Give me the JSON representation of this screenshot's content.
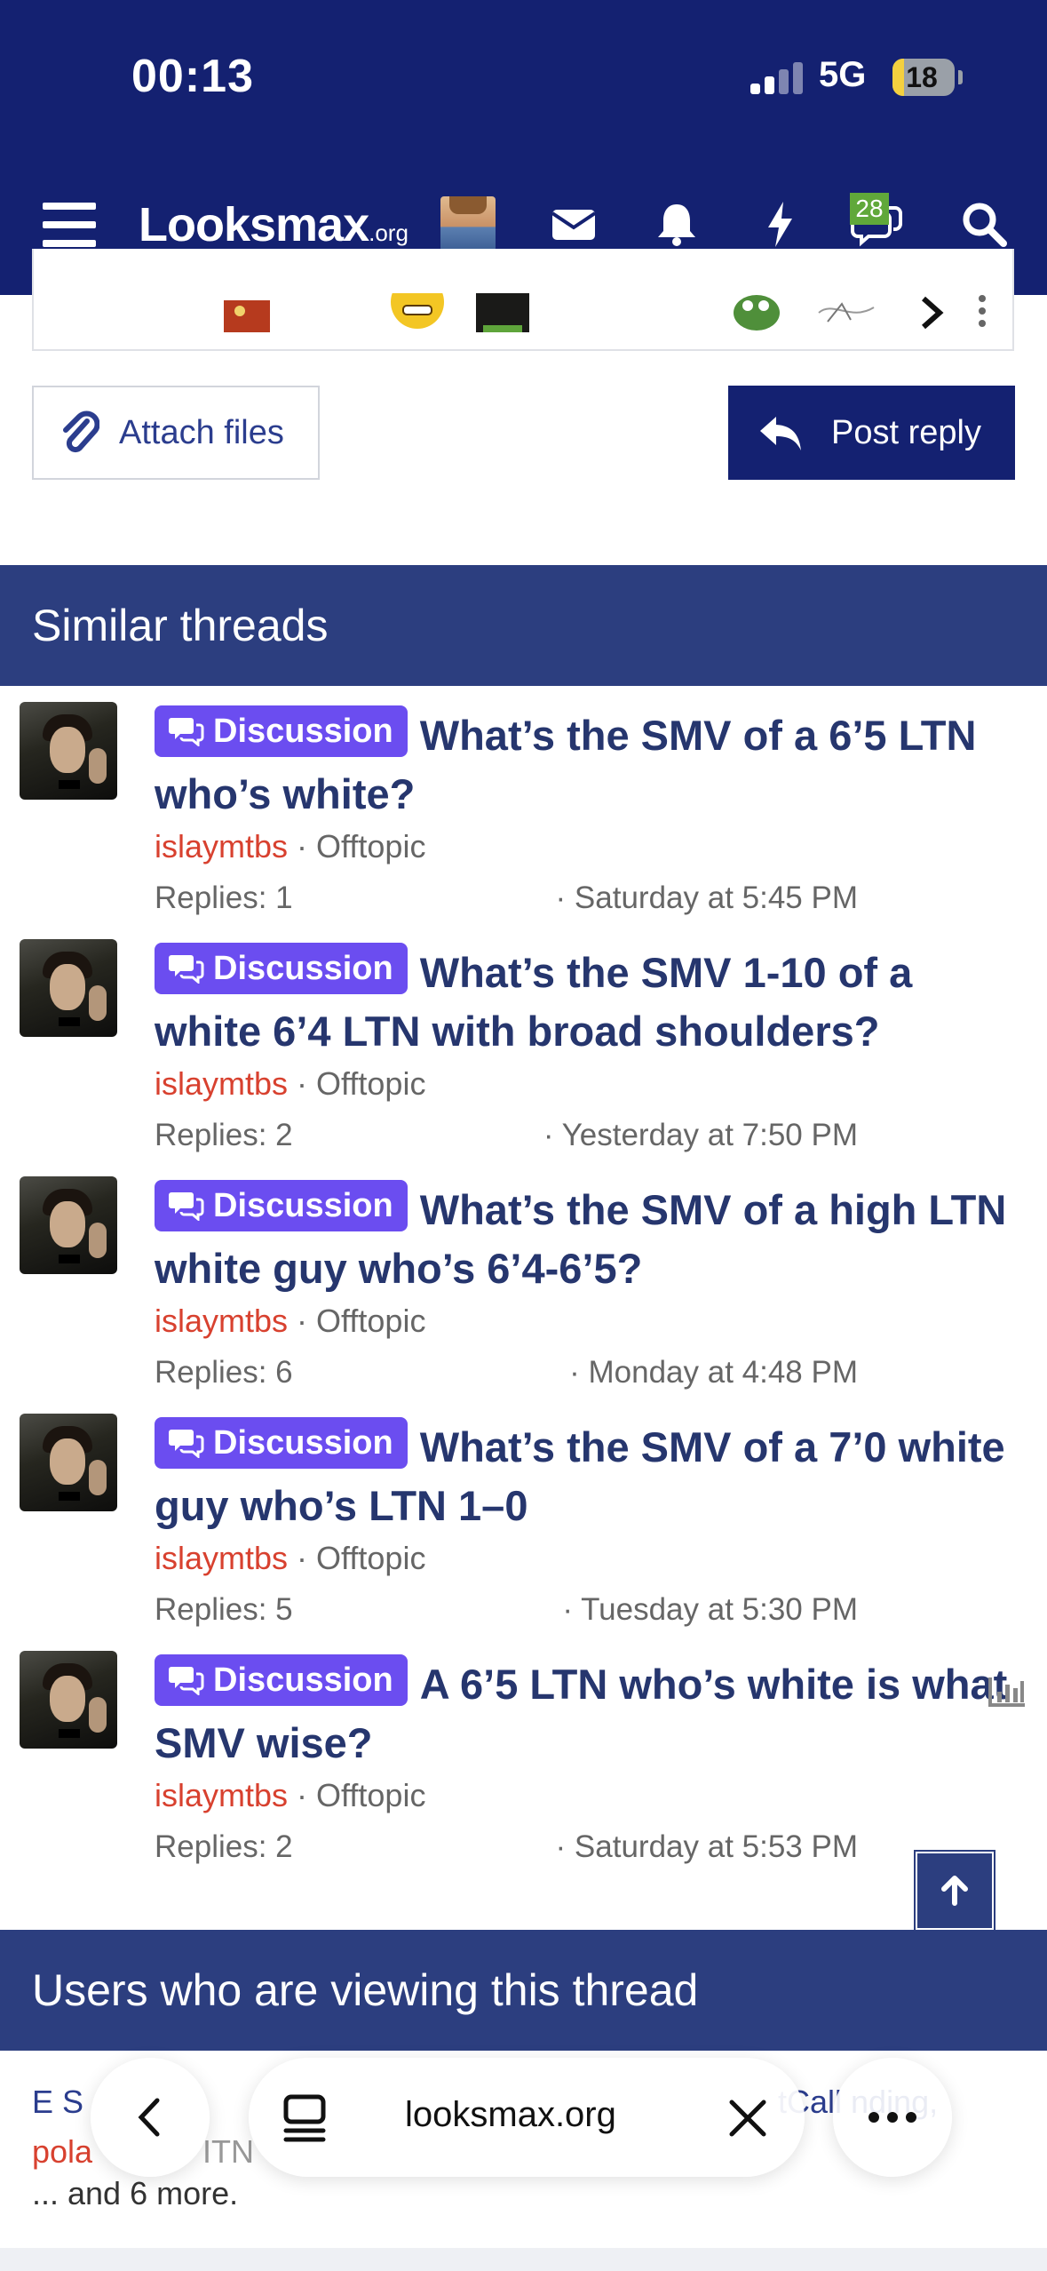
{
  "status_bar": {
    "time": "00:13",
    "network": "5G",
    "battery": "18",
    "battery_level": 0.18
  },
  "header": {
    "brand": "Looksmax",
    "brand_suffix": ".org",
    "conversations_badge": "28",
    "icons": [
      "menu-icon",
      "user-avatar",
      "mail-icon",
      "bell-icon",
      "lightning-icon",
      "chat-bubbles-icon",
      "search-icon"
    ]
  },
  "actions": {
    "attach_label": "Attach files",
    "post_label": "Post reply"
  },
  "similar": {
    "heading": "Similar threads",
    "threads": [
      {
        "prefix": "Discussion",
        "title": "What’s the SMV of a 6’5 LTN who’s white?",
        "author": "islaymtbs",
        "forum": "Offtopic",
        "replies": "Replies: 1",
        "date": "Saturday at 5:45 PM"
      },
      {
        "prefix": "Discussion",
        "title": "What’s the SMV 1-10 of a white 6’4 LTN with broad shoulders?",
        "author": "islaymtbs",
        "forum": "Offtopic",
        "replies": "Replies: 2",
        "date": "Yesterday at 7:50 PM"
      },
      {
        "prefix": "Discussion",
        "title": "What’s the SMV of a high LTN white guy who’s 6’4-6’5?",
        "author": "islaymtbs",
        "forum": "Offtopic",
        "replies": "Replies: 6",
        "date": "Monday at 4:48 PM"
      },
      {
        "prefix": "Discussion",
        "title": "What’s the SMV of a 7’0 white guy who’s LTN 1–0",
        "author": "islaymtbs",
        "forum": "Offtopic",
        "replies": "Replies: 5",
        "date": "Tuesday at 5:30 PM"
      },
      {
        "prefix": "Discussion",
        "title": "A 6’5 LTN who’s white is what SMV wise?",
        "author": "islaymtbs",
        "forum": "Offtopic",
        "replies": "Replies: 2",
        "date": "Saturday at 5:53 PM",
        "has_poll": true
      }
    ]
  },
  "viewers": {
    "heading": "Users who are viewing this thread",
    "line1": "E S",
    "line1_end": "tCall nding,",
    "line2": "pola",
    "line2_mid": "ITN",
    "more": "... and 6 more."
  },
  "browser": {
    "url": "looksmax.org",
    "icons": [
      "back-icon",
      "tabs-icon",
      "close-icon",
      "more-icon"
    ]
  },
  "colors": {
    "header_bg": "#142171",
    "section_bg": "#2c3e7f",
    "title": "#26366e",
    "prefix": "#6b4df0",
    "author": "#d8412f"
  }
}
